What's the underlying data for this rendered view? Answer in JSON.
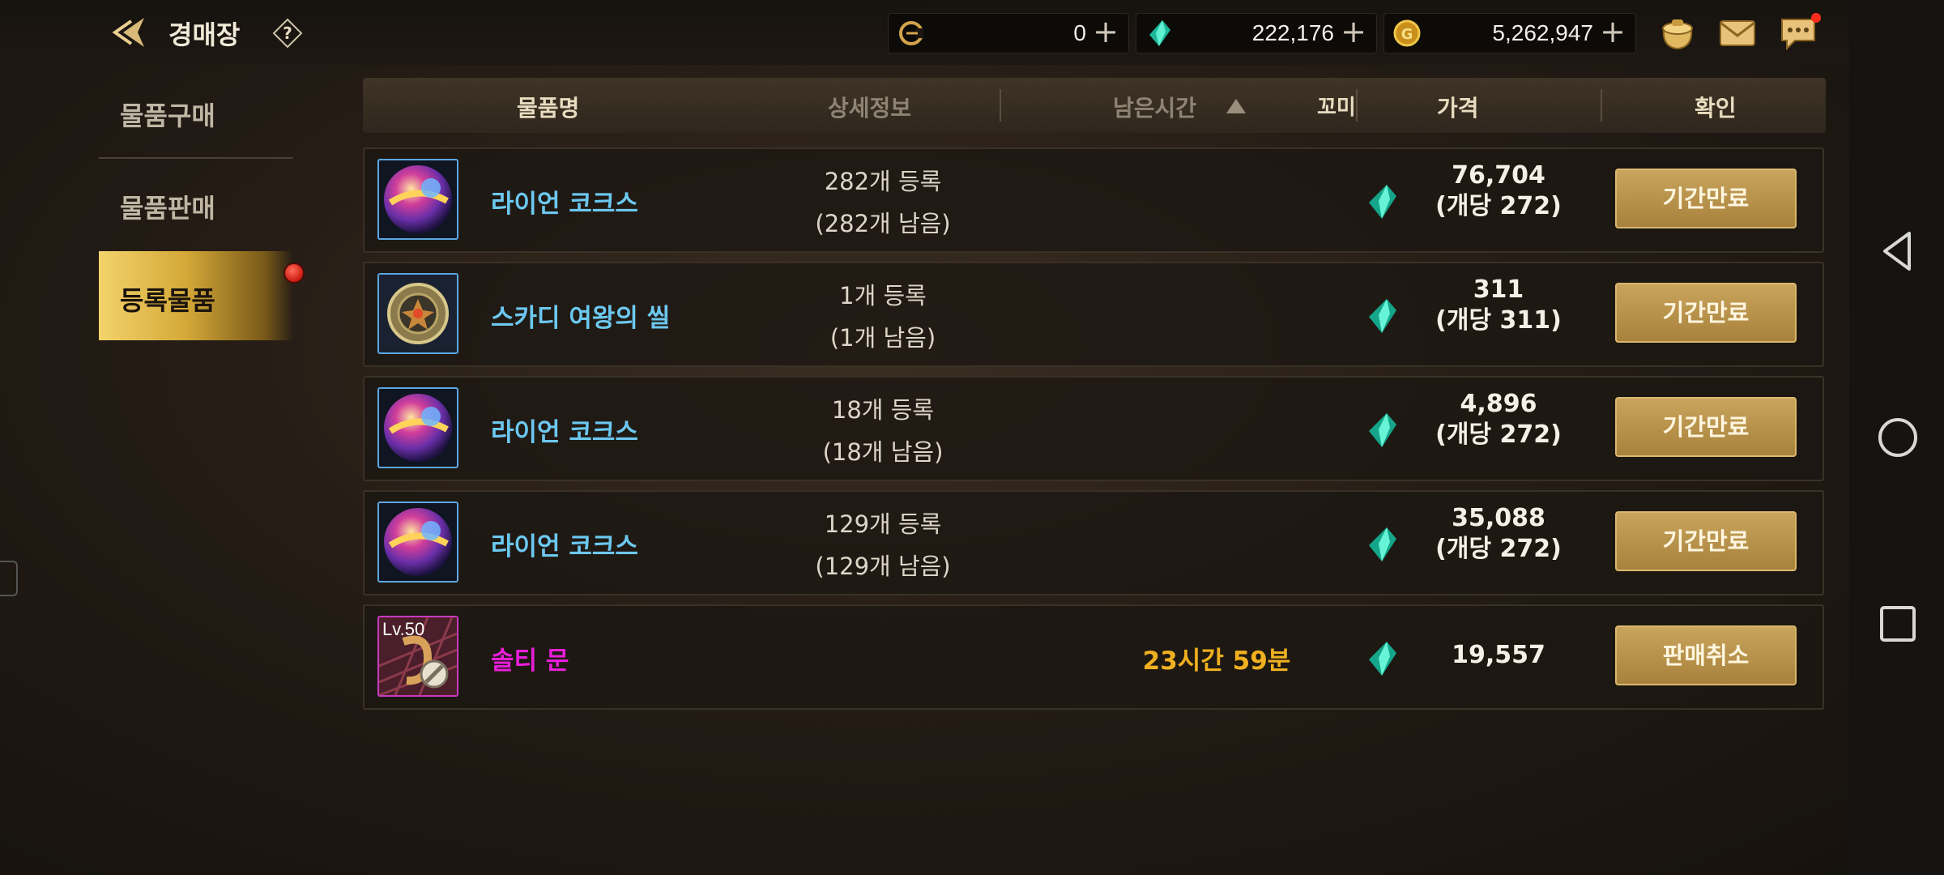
{
  "header": {
    "title": "경매장",
    "currencies": [
      {
        "icon": "c-coin-icon",
        "value": "0"
      },
      {
        "icon": "green-gem-icon",
        "value": "222,176"
      },
      {
        "icon": "gold-coin-icon",
        "value": "5,262,947"
      }
    ],
    "icons": [
      "bag-icon",
      "mail-icon",
      "chat-icon"
    ]
  },
  "menu": {
    "items": [
      {
        "label": "물품구매",
        "active": false
      },
      {
        "label": "물품판매",
        "active": false
      },
      {
        "label": "등록물품",
        "active": true
      }
    ]
  },
  "table": {
    "columns": {
      "name": "물품명",
      "detail": "상세정보",
      "time": "남은시간",
      "sort": "꼬미",
      "price": "가격",
      "confirm": "확인"
    },
    "rows": [
      {
        "name": "라이언 코크스",
        "registered": "282개 등록",
        "remaining": "(282개 남음)",
        "time": "",
        "price": "76,704",
        "unit": "(개당 272)",
        "action": "기간만료"
      },
      {
        "name": "스카디 여왕의 씰",
        "registered": "1개 등록",
        "remaining": "(1개 남음)",
        "time": "",
        "price": "311",
        "unit": "(개당 311)",
        "action": "기간만료"
      },
      {
        "name": "라이언 코크스",
        "registered": "18개 등록",
        "remaining": "(18개 남음)",
        "time": "",
        "price": "4,896",
        "unit": "(개당 272)",
        "action": "기간만료"
      },
      {
        "name": "라이언 코크스",
        "registered": "129개 등록",
        "remaining": "(129개 남음)",
        "time": "",
        "price": "35,088",
        "unit": "(개당 272)",
        "action": "기간만료"
      },
      {
        "name": "솔티 문",
        "level": "Lv.50",
        "registered": "",
        "remaining": "",
        "time": "23시간 59분",
        "price": "19,557",
        "unit": "",
        "action": "판매취소"
      }
    ]
  },
  "colors": {
    "item_name": "#6cc8f0",
    "rare_name": "#e81ed8",
    "time": "#f0b020",
    "button": "#b8924a"
  }
}
